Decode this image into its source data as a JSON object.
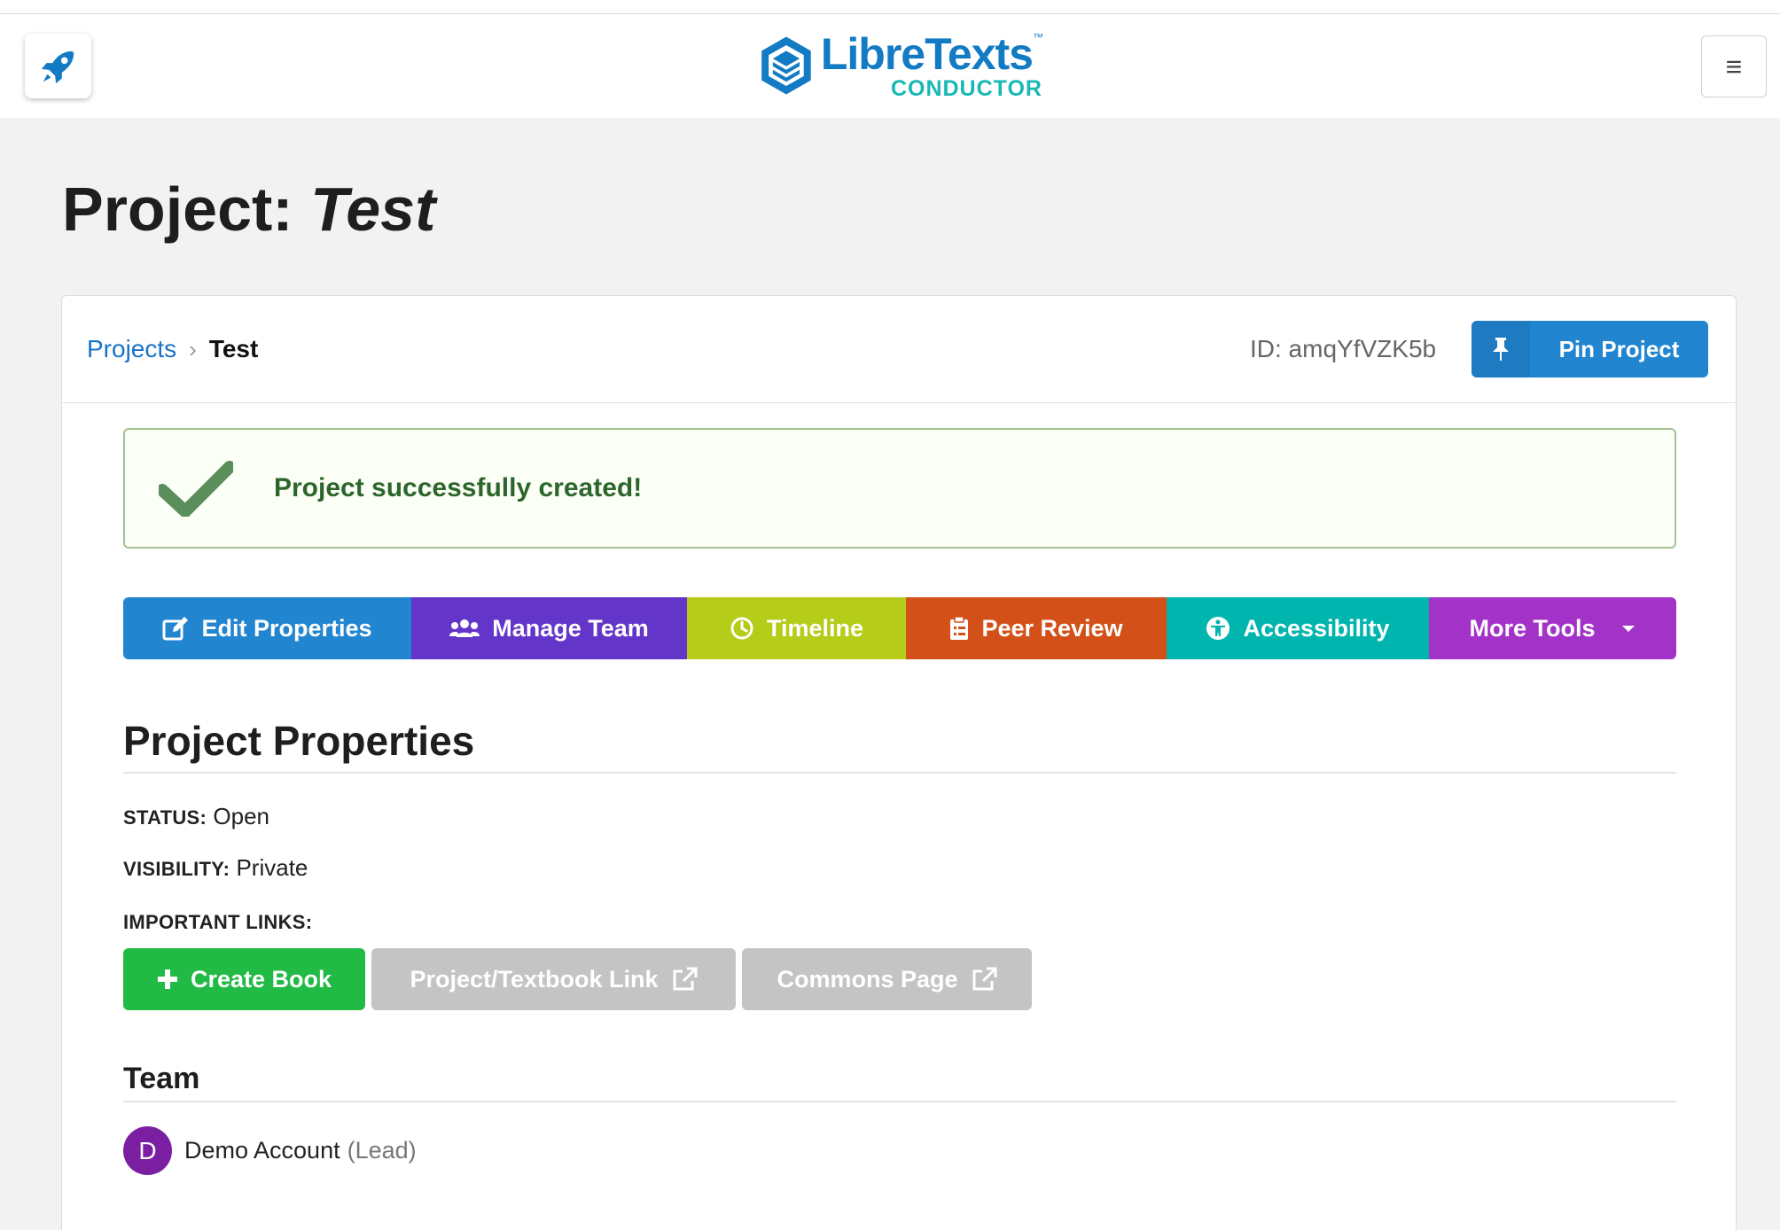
{
  "header": {
    "logo_main": "LibreTexts",
    "logo_tm": "™",
    "logo_sub": "CONDUCTOR",
    "menu_glyph": "≡"
  },
  "page": {
    "title_prefix": "Project:",
    "title_name": "Test"
  },
  "breadcrumb": {
    "root": "Projects",
    "separator": "›",
    "current": "Test"
  },
  "project_id": "ID: amqYfVZK5b",
  "pin_button": {
    "label": "Pin Project"
  },
  "success_message": "Project successfully created!",
  "toolbar": [
    {
      "label": "Edit Properties",
      "icon": "edit-icon",
      "color": "#2185d0"
    },
    {
      "label": "Manage Team",
      "icon": "users-icon",
      "color": "#6435c9"
    },
    {
      "label": "Timeline",
      "icon": "clock-icon",
      "color": "#b5cc18"
    },
    {
      "label": "Peer Review",
      "icon": "clipboard-icon",
      "color": "#d35118"
    },
    {
      "label": "Accessibility",
      "icon": "accessibility-icon",
      "color": "#00b5ad"
    },
    {
      "label": "More Tools",
      "icon": "caret-down-icon",
      "color": "#a333c8"
    }
  ],
  "properties": {
    "heading": "Project Properties",
    "status_key": "STATUS:",
    "status_value": "Open",
    "visibility_key": "VISIBILITY:",
    "visibility_value": "Private",
    "links_key": "IMPORTANT LINKS:"
  },
  "links": [
    {
      "label": "Create Book",
      "icon": "plus-icon",
      "color": "#21ba45"
    },
    {
      "label": "Project/Textbook Link",
      "icon": "external-link-icon",
      "color": "#c4c4c4"
    },
    {
      "label": "Commons Page",
      "icon": "external-link-icon",
      "color": "#c4c4c4"
    }
  ],
  "team": {
    "heading": "Team",
    "members": [
      {
        "initial": "D",
        "name": "Demo Account",
        "role": "(Lead)",
        "avatar_color": "#7b1fa2"
      }
    ]
  }
}
